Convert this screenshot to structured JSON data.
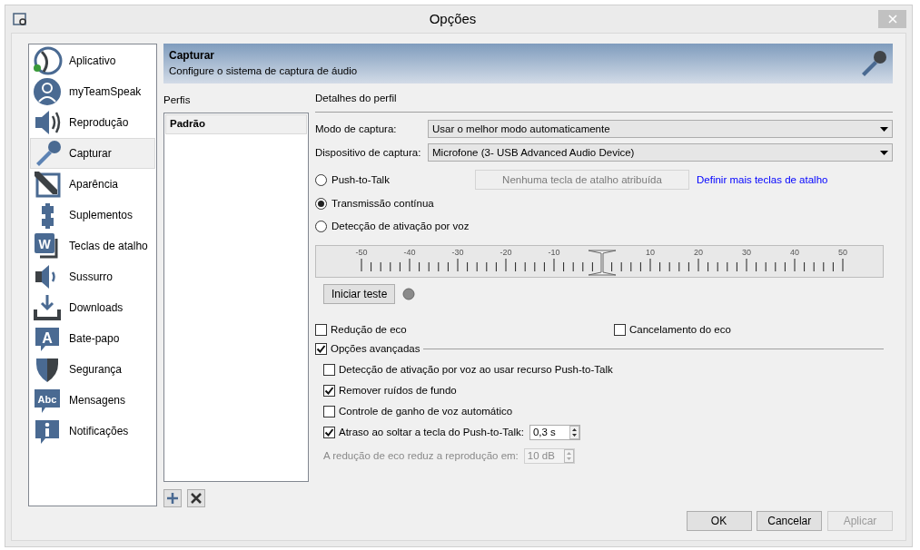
{
  "window": {
    "title": "Opções"
  },
  "sidebar": {
    "items": [
      {
        "label": "Aplicativo",
        "kind": "app",
        "selected": false
      },
      {
        "label": "myTeamSpeak",
        "kind": "user",
        "selected": false
      },
      {
        "label": "Reprodução",
        "kind": "speaker",
        "selected": false
      },
      {
        "label": "Capturar",
        "kind": "mic",
        "selected": true
      },
      {
        "label": "Aparência",
        "kind": "pen",
        "selected": false
      },
      {
        "label": "Suplementos",
        "kind": "puzzle",
        "selected": false
      },
      {
        "label": "Teclas de atalho",
        "kind": "key",
        "icon_text": "W",
        "selected": false
      },
      {
        "label": "Sussurro",
        "kind": "whisper",
        "selected": false
      },
      {
        "label": "Downloads",
        "kind": "download",
        "selected": false
      },
      {
        "label": "Bate-papo",
        "kind": "chat",
        "icon_text": "A",
        "selected": false
      },
      {
        "label": "Segurança",
        "kind": "shield",
        "selected": false
      },
      {
        "label": "Mensagens",
        "kind": "abc",
        "icon_text": "Abc",
        "selected": false
      },
      {
        "label": "Notificações",
        "kind": "info",
        "selected": false
      }
    ]
  },
  "header": {
    "title": "Capturar",
    "subtitle": "Configure o sistema de captura de áudio"
  },
  "profiles": {
    "label": "Perfis",
    "items": [
      {
        "label": "Padrão",
        "selected": true
      }
    ]
  },
  "details": {
    "title": "Detalhes do perfil",
    "capture_mode": {
      "label": "Modo de captura:",
      "value": "Usar o melhor modo automaticamente"
    },
    "capture_device": {
      "label": "Dispositivo de captura:",
      "value": "Microfone (3- USB Advanced Audio Device)"
    },
    "modes": [
      {
        "label": "Push-to-Talk",
        "selected": false
      },
      {
        "label": "Transmissão contínua",
        "selected": true
      },
      {
        "label": "Detecção de ativação por voz",
        "selected": false
      }
    ],
    "hotkey_button": {
      "label": "Nenhuma tecla de atalho atribuída",
      "disabled": true
    },
    "hotkey_link": "Definir mais teclas de atalho",
    "threshold": {
      "level": 0.5,
      "tick_labels": [
        "-50",
        "-40",
        "-30",
        "-20",
        "-10",
        "10",
        "20",
        "30",
        "40",
        "50"
      ]
    },
    "test_button": "Iniciar teste",
    "echo_reduction": {
      "label": "Redução de eco",
      "checked": false
    },
    "echo_cancel": {
      "label": "Cancelamento do eco",
      "checked": false
    },
    "advanced": {
      "label": "Opções avançadas",
      "checked": true,
      "options": [
        {
          "label": "Detecção de ativação por voz ao usar recurso Push-to-Talk",
          "checked": false
        },
        {
          "label": "Remover ruídos de fundo",
          "checked": true
        },
        {
          "label": "Controle de ganho de voz automático",
          "checked": false
        }
      ]
    },
    "ptt_delay": {
      "label": "Atraso ao soltar a tecla do Push-to-Talk:",
      "checked": true,
      "value": "0,3 s"
    },
    "echo_amount": {
      "label": "A redução de eco reduz a reprodução em:",
      "value": "10 dB",
      "disabled": true
    }
  },
  "buttons": [
    {
      "label": "OK",
      "disabled": false
    },
    {
      "label": "Cancelar",
      "disabled": false
    },
    {
      "label": "Aplicar",
      "disabled": true
    }
  ]
}
